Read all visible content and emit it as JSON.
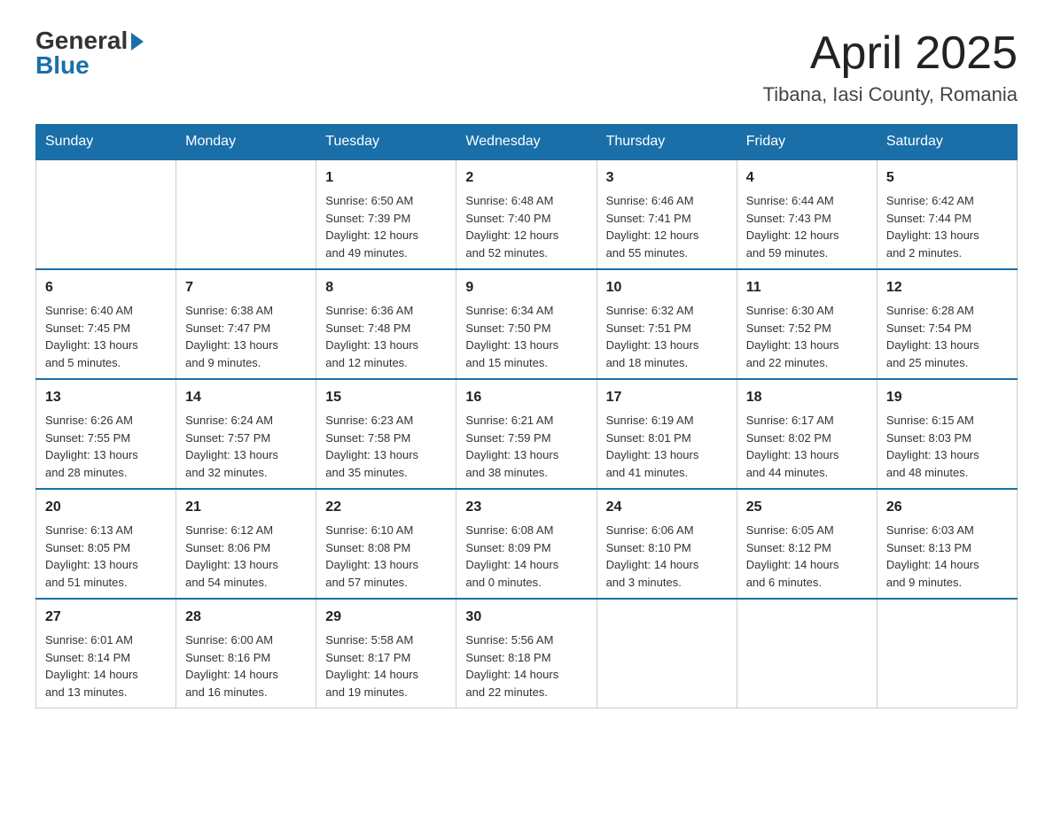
{
  "header": {
    "logo_general": "General",
    "logo_blue": "Blue",
    "month_title": "April 2025",
    "location": "Tibana, Iasi County, Romania"
  },
  "days_of_week": [
    "Sunday",
    "Monday",
    "Tuesday",
    "Wednesday",
    "Thursday",
    "Friday",
    "Saturday"
  ],
  "weeks": [
    [
      {
        "day": "",
        "data": ""
      },
      {
        "day": "",
        "data": ""
      },
      {
        "day": "1",
        "data": "Sunrise: 6:50 AM\nSunset: 7:39 PM\nDaylight: 12 hours\nand 49 minutes."
      },
      {
        "day": "2",
        "data": "Sunrise: 6:48 AM\nSunset: 7:40 PM\nDaylight: 12 hours\nand 52 minutes."
      },
      {
        "day": "3",
        "data": "Sunrise: 6:46 AM\nSunset: 7:41 PM\nDaylight: 12 hours\nand 55 minutes."
      },
      {
        "day": "4",
        "data": "Sunrise: 6:44 AM\nSunset: 7:43 PM\nDaylight: 12 hours\nand 59 minutes."
      },
      {
        "day": "5",
        "data": "Sunrise: 6:42 AM\nSunset: 7:44 PM\nDaylight: 13 hours\nand 2 minutes."
      }
    ],
    [
      {
        "day": "6",
        "data": "Sunrise: 6:40 AM\nSunset: 7:45 PM\nDaylight: 13 hours\nand 5 minutes."
      },
      {
        "day": "7",
        "data": "Sunrise: 6:38 AM\nSunset: 7:47 PM\nDaylight: 13 hours\nand 9 minutes."
      },
      {
        "day": "8",
        "data": "Sunrise: 6:36 AM\nSunset: 7:48 PM\nDaylight: 13 hours\nand 12 minutes."
      },
      {
        "day": "9",
        "data": "Sunrise: 6:34 AM\nSunset: 7:50 PM\nDaylight: 13 hours\nand 15 minutes."
      },
      {
        "day": "10",
        "data": "Sunrise: 6:32 AM\nSunset: 7:51 PM\nDaylight: 13 hours\nand 18 minutes."
      },
      {
        "day": "11",
        "data": "Sunrise: 6:30 AM\nSunset: 7:52 PM\nDaylight: 13 hours\nand 22 minutes."
      },
      {
        "day": "12",
        "data": "Sunrise: 6:28 AM\nSunset: 7:54 PM\nDaylight: 13 hours\nand 25 minutes."
      }
    ],
    [
      {
        "day": "13",
        "data": "Sunrise: 6:26 AM\nSunset: 7:55 PM\nDaylight: 13 hours\nand 28 minutes."
      },
      {
        "day": "14",
        "data": "Sunrise: 6:24 AM\nSunset: 7:57 PM\nDaylight: 13 hours\nand 32 minutes."
      },
      {
        "day": "15",
        "data": "Sunrise: 6:23 AM\nSunset: 7:58 PM\nDaylight: 13 hours\nand 35 minutes."
      },
      {
        "day": "16",
        "data": "Sunrise: 6:21 AM\nSunset: 7:59 PM\nDaylight: 13 hours\nand 38 minutes."
      },
      {
        "day": "17",
        "data": "Sunrise: 6:19 AM\nSunset: 8:01 PM\nDaylight: 13 hours\nand 41 minutes."
      },
      {
        "day": "18",
        "data": "Sunrise: 6:17 AM\nSunset: 8:02 PM\nDaylight: 13 hours\nand 44 minutes."
      },
      {
        "day": "19",
        "data": "Sunrise: 6:15 AM\nSunset: 8:03 PM\nDaylight: 13 hours\nand 48 minutes."
      }
    ],
    [
      {
        "day": "20",
        "data": "Sunrise: 6:13 AM\nSunset: 8:05 PM\nDaylight: 13 hours\nand 51 minutes."
      },
      {
        "day": "21",
        "data": "Sunrise: 6:12 AM\nSunset: 8:06 PM\nDaylight: 13 hours\nand 54 minutes."
      },
      {
        "day": "22",
        "data": "Sunrise: 6:10 AM\nSunset: 8:08 PM\nDaylight: 13 hours\nand 57 minutes."
      },
      {
        "day": "23",
        "data": "Sunrise: 6:08 AM\nSunset: 8:09 PM\nDaylight: 14 hours\nand 0 minutes."
      },
      {
        "day": "24",
        "data": "Sunrise: 6:06 AM\nSunset: 8:10 PM\nDaylight: 14 hours\nand 3 minutes."
      },
      {
        "day": "25",
        "data": "Sunrise: 6:05 AM\nSunset: 8:12 PM\nDaylight: 14 hours\nand 6 minutes."
      },
      {
        "day": "26",
        "data": "Sunrise: 6:03 AM\nSunset: 8:13 PM\nDaylight: 14 hours\nand 9 minutes."
      }
    ],
    [
      {
        "day": "27",
        "data": "Sunrise: 6:01 AM\nSunset: 8:14 PM\nDaylight: 14 hours\nand 13 minutes."
      },
      {
        "day": "28",
        "data": "Sunrise: 6:00 AM\nSunset: 8:16 PM\nDaylight: 14 hours\nand 16 minutes."
      },
      {
        "day": "29",
        "data": "Sunrise: 5:58 AM\nSunset: 8:17 PM\nDaylight: 14 hours\nand 19 minutes."
      },
      {
        "day": "30",
        "data": "Sunrise: 5:56 AM\nSunset: 8:18 PM\nDaylight: 14 hours\nand 22 minutes."
      },
      {
        "day": "",
        "data": ""
      },
      {
        "day": "",
        "data": ""
      },
      {
        "day": "",
        "data": ""
      }
    ]
  ]
}
